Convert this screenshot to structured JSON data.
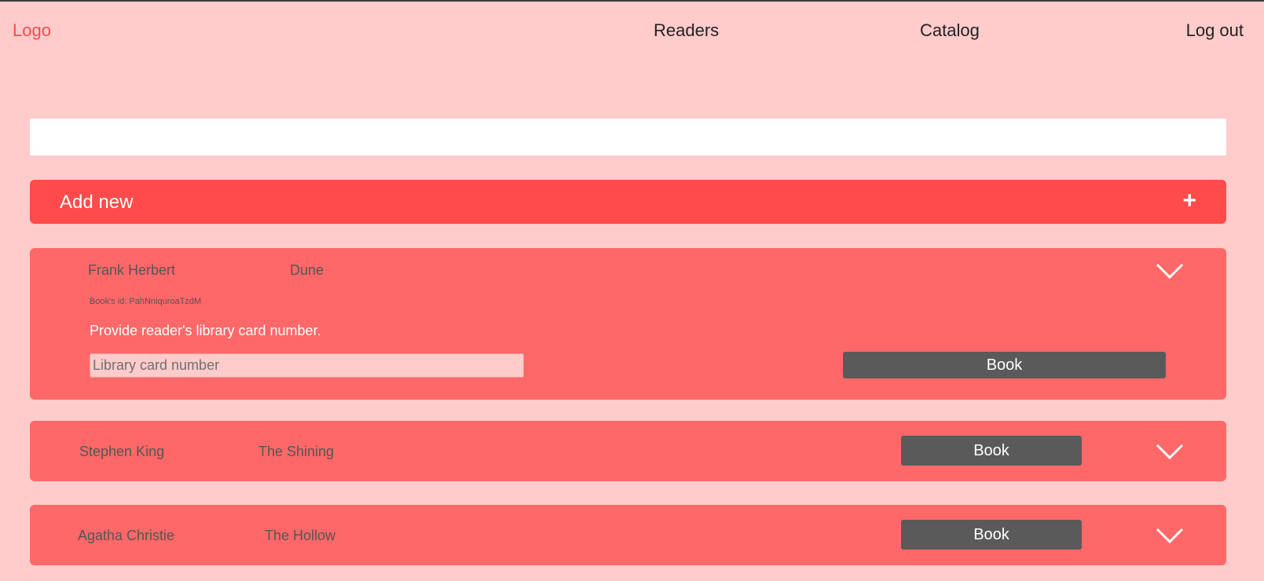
{
  "nav": {
    "logo": "Logo",
    "readers": "Readers",
    "catalog": "Catalog",
    "logout": "Log out"
  },
  "add_new": {
    "label": "Add new",
    "icon": "+"
  },
  "books": [
    {
      "author": "Frank Herbert",
      "title": "Dune",
      "id_label": "Book's id: PahNniquroaTzdM",
      "prompt": "Provide reader's library card number.",
      "input_placeholder": "Library card number",
      "button": "Book"
    },
    {
      "author": "Stephen King",
      "title": "The Shining",
      "button": "Book"
    },
    {
      "author": "Agatha Christie",
      "title": "The Hollow",
      "button": "Book"
    }
  ],
  "colors": {
    "background": "#ffcbcb",
    "accent": "#ff4b4b",
    "card": "#ff6868",
    "button": "#5a5a5a"
  }
}
